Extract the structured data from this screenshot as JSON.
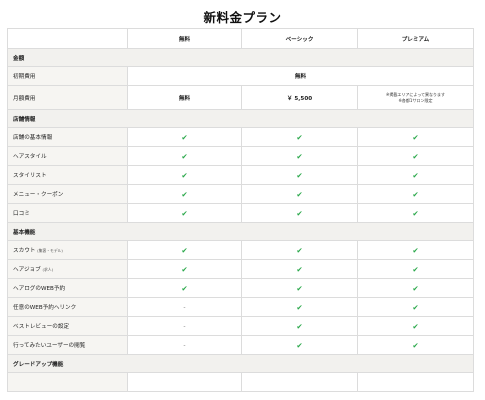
{
  "page_title": "新料金プラン",
  "columns": [
    "",
    "無料",
    "ベーシック",
    "プレミアム"
  ],
  "sections": {
    "price": "金額",
    "store": "店舗情報",
    "basic": "基本機能",
    "upgrade": "グレードアップ機能"
  },
  "price_rows": {
    "initial_label": "初期費用",
    "initial_value": "無料",
    "monthly_label": "月額費用",
    "monthly_free": "無料",
    "monthly_basic": "￥ 5,500",
    "monthly_premium_note1": "※掲載エリアによって異なります",
    "monthly_premium_note2": "※各都1サロン限定"
  },
  "store_rows": [
    "店舗の基本情報",
    "ヘアスタイル",
    "スタイリスト",
    "メニュー・クーポン",
    "口コミ"
  ],
  "basic_rows": {
    "scout": "スカウト",
    "scout_small": "(集客・モデル)",
    "hairjob": "ヘアジョブ",
    "hairjob_small": "(求人)",
    "web_booking": "ヘアログのWEB予約",
    "any_link": "任意のWEB予約ヘリンク",
    "best_review": "ベストレビューの設定",
    "want_visit": "行ってみたいユーザーの閲覧"
  },
  "marks": {
    "check": "✔",
    "dash": "-"
  },
  "colors": {
    "check": "#2aa84a",
    "label_bg": "#f6f5f2",
    "section_bg": "#f2f1ee"
  }
}
